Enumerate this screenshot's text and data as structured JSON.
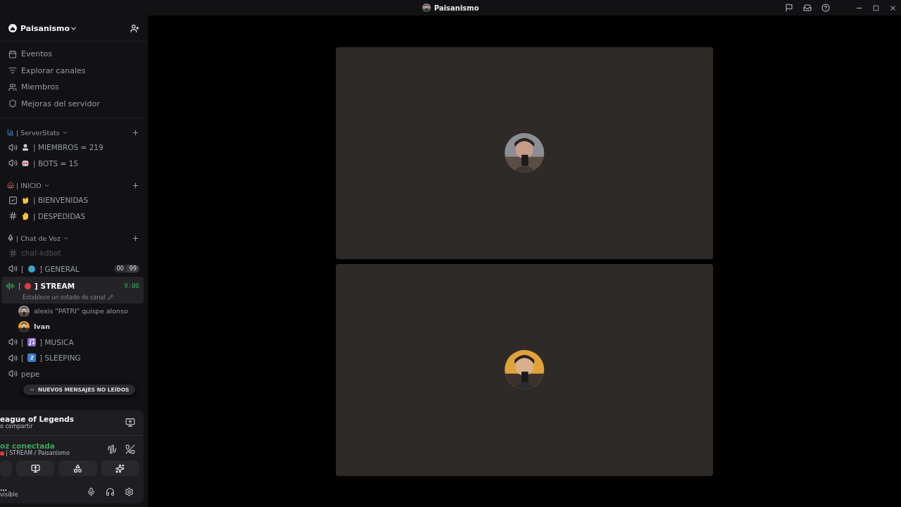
{
  "titlebar": {
    "title": "Paisanismo"
  },
  "server": {
    "name": "Paisanismo"
  },
  "nav": [
    {
      "kind": "calendar",
      "label": "Eventos"
    },
    {
      "kind": "browse",
      "label": "Explorar canales"
    },
    {
      "kind": "members",
      "label": "Miembros"
    },
    {
      "kind": "boost",
      "label": "Mejoras del servidor"
    }
  ],
  "categories": [
    {
      "kind": "stats",
      "name": "| ServerStats",
      "channels": [
        {
          "kind": "voice",
          "emoji": {
            "kind": "person"
          },
          "name": "| MIEMBROS = 219",
          "muted": false,
          "selected": false
        },
        {
          "kind": "voice",
          "emoji": {
            "kind": "robot"
          },
          "name": "| BOTS = 15",
          "muted": false,
          "selected": false
        }
      ]
    },
    {
      "kind": "home",
      "name": "| INICIO",
      "channels": [
        {
          "kind": "rules",
          "emoji": {
            "kind": "wave"
          },
          "name": "| BIENVENIDAS",
          "muted": false,
          "selected": false
        },
        {
          "kind": "text",
          "emoji": {
            "kind": "hand"
          },
          "name": "| DESPEDIDAS",
          "muted": false,
          "selected": false
        }
      ]
    },
    {
      "kind": "mic",
      "name": "| Chat de Voz",
      "channels": [
        {
          "kind": "text",
          "name": "chat-kdbot",
          "muted": true,
          "selected": false
        },
        {
          "kind": "voice",
          "open": "[",
          "emoji": {
            "kind": "globe"
          },
          "name": "] GENERAL",
          "muted": false,
          "selected": false,
          "counts": [
            "00",
            "99"
          ]
        },
        {
          "kind": "live",
          "open": "[",
          "emoji": {
            "kind": "redcircle"
          },
          "name": "] STREAM",
          "muted": false,
          "selected": true,
          "time": "9:06",
          "status": "Establece un estado de canal",
          "members": [
            {
              "name": "alexis \"PATRI\" quispe alonso",
              "bold": false
            },
            {
              "name": "Ivan",
              "bold": true
            }
          ]
        },
        {
          "kind": "voice",
          "open": "[",
          "emoji": {
            "kind": "music"
          },
          "name": "] MUSICA",
          "muted": false,
          "selected": false
        },
        {
          "kind": "voice",
          "open": "[",
          "emoji": {
            "kind": "zzz"
          },
          "name": "] SLEEPING",
          "muted": false,
          "selected": false
        },
        {
          "kind": "voice",
          "name": "pepe",
          "muted": false,
          "selected": false
        }
      ]
    }
  ],
  "unread_pill": "NUEVOS MENSAJES NO LEÍDOS",
  "activity": {
    "title": "eague of Legends",
    "subtitle": "o compartir"
  },
  "voice": {
    "status": "oz conectada",
    "location": "| STREAM / Paisanismo"
  },
  "user": {
    "name": "...",
    "status": "visible"
  }
}
